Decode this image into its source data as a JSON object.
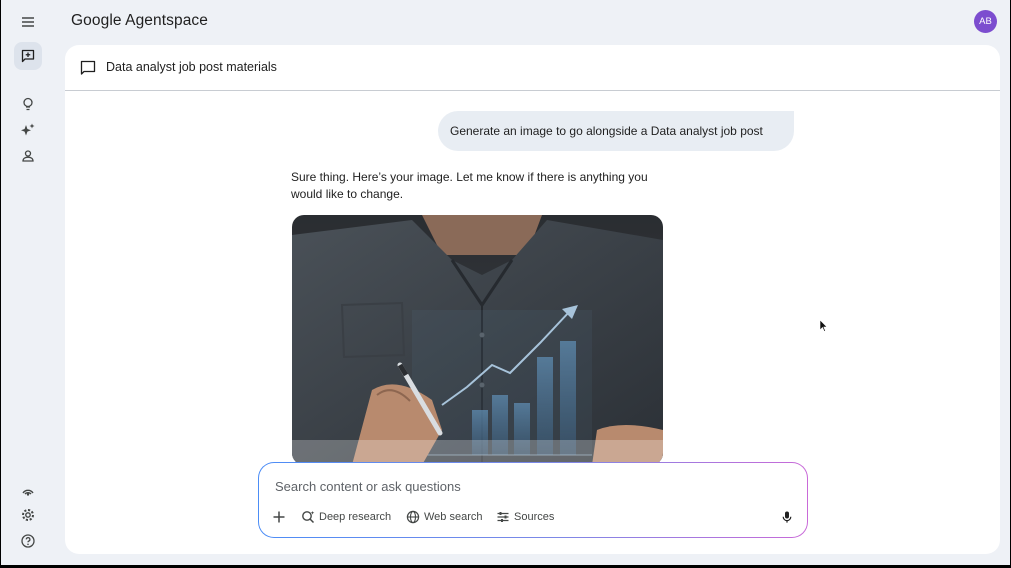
{
  "header": {
    "app_title": "Google Agentspace",
    "avatar_initials": "AB"
  },
  "conversation": {
    "title": "Data analyst job post materials",
    "user_message": "Generate an image to go alongside a Data analyst job post",
    "assistant_reply": "Sure thing. Here’s your image. Let me know if there is anything you would like to change."
  },
  "composer": {
    "placeholder": "Search content or ask questions",
    "tools": {
      "deep_research": "Deep research",
      "web_search": "Web search",
      "sources": "Sources"
    }
  },
  "rail": {
    "top_icons": [
      "menu-icon",
      "new-chat-icon",
      "lightbulb-icon",
      "sparkle-icon",
      "person-icon"
    ],
    "bottom_icons": [
      "podcast-icon",
      "settings-icon",
      "help-icon"
    ]
  },
  "colors": {
    "background": "#eef1f6",
    "card": "#ffffff",
    "user_bubble": "#e8edf3",
    "avatar": "#7c4dcf",
    "composer_gradient": [
      "#4c8df6",
      "#c96ad8"
    ]
  }
}
